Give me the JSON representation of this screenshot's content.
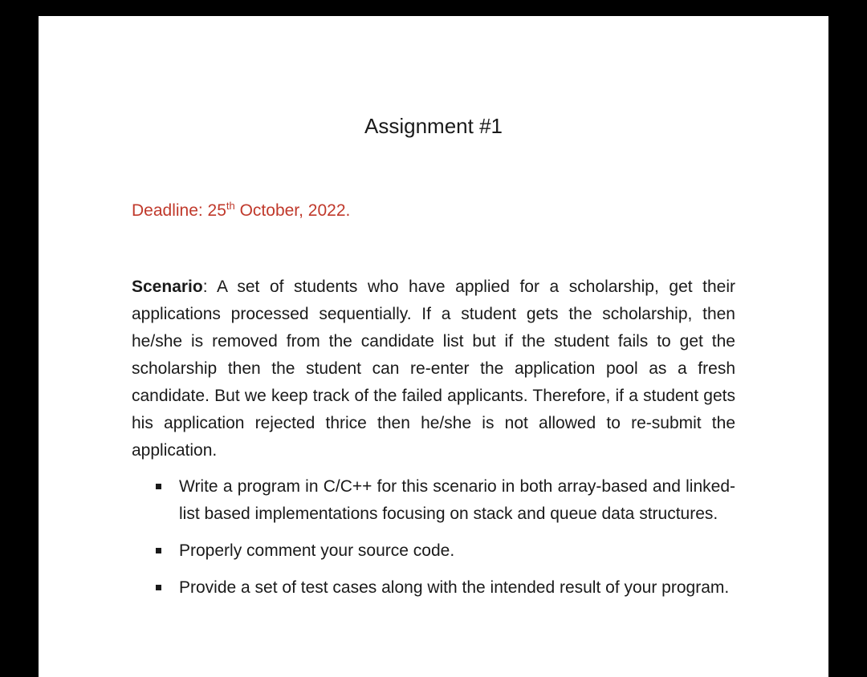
{
  "document": {
    "title": "Assignment #1",
    "deadline": {
      "label": "Deadline: 25",
      "superscript": "th",
      "rest": " October, 2022."
    },
    "scenario": {
      "label": "Scenario",
      "text": ": A set of students who have applied for a scholarship, get their applications processed sequentially.  If a student gets the scholarship, then he/she is removed from the candidate list but if the student fails to get the scholarship then the student can re-enter the application pool as a fresh candidate. But we keep track of the failed applicants. Therefore, if a student gets his application rejected thrice then he/she is not allowed to re-submit the application."
    },
    "bullets": [
      "Write a program in C/C++ for this scenario in both array-based and linked-list based implementations focusing on stack and queue data structures.",
      "Properly comment your source code.",
      "Provide a set of test cases along with the intended result of your program."
    ]
  },
  "colors": {
    "deadline_text": "#c0392b",
    "body_text": "#1a1a1a",
    "page_background": "#ffffff",
    "frame_background": "#000000"
  },
  "icons": [
    "square-bullet-icon"
  ]
}
